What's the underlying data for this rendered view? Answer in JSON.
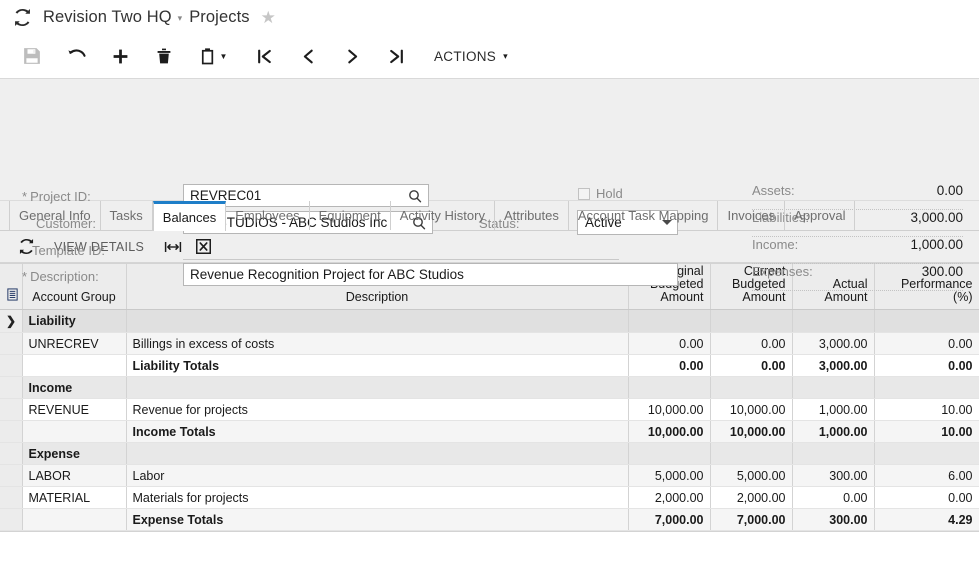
{
  "titlebar": {
    "refresh_icon": "refresh-icon",
    "company": "Revision Two HQ",
    "caret": "▾",
    "page": "Projects",
    "favorite_icon": "★"
  },
  "toolbar": {
    "buttons": [
      {
        "name": "save-button",
        "icon": "save-icon",
        "disabled": true
      },
      {
        "name": "undo-button",
        "icon": "undo-icon",
        "disabled": false
      },
      {
        "name": "add-button",
        "icon": "plus-icon",
        "disabled": false
      },
      {
        "name": "delete-button",
        "icon": "trash-icon",
        "disabled": false
      },
      {
        "name": "clipboard-button",
        "icon": "clipboard-icon",
        "disabled": false
      },
      {
        "name": "first-record-button",
        "icon": "first-icon",
        "disabled": false
      },
      {
        "name": "previous-record-button",
        "icon": "prev-icon",
        "disabled": false
      },
      {
        "name": "next-record-button",
        "icon": "next-icon",
        "disabled": false
      },
      {
        "name": "last-record-button",
        "icon": "last-icon",
        "disabled": false
      }
    ],
    "actions_label": "ACTIONS",
    "actions_caret": "▾"
  },
  "form": {
    "project_id": {
      "label": "Project ID:",
      "required": true,
      "value": "REVREC01",
      "placeholder": ""
    },
    "customer": {
      "label": "Customer:",
      "required": false,
      "value": "ABCSTUDIOS - ABC Studios Inc",
      "placeholder": ""
    },
    "template_id": {
      "label": "Template ID:",
      "required": false,
      "value": "",
      "placeholder": ""
    },
    "description": {
      "label": "Description:",
      "required": true,
      "value": "Revenue Recognition Project for ABC Studios",
      "placeholder": ""
    },
    "hold": {
      "label": "Hold",
      "checked": false
    },
    "status": {
      "label": "Status:",
      "value": "Active"
    },
    "summary": [
      {
        "label": "Assets:",
        "value": "0.00"
      },
      {
        "label": "Liabilities:",
        "value": "3,000.00"
      },
      {
        "label": "Income:",
        "value": "1,000.00"
      },
      {
        "label": "Expenses:",
        "value": "300.00"
      }
    ]
  },
  "tabs": [
    {
      "label": "General Info",
      "active": false
    },
    {
      "label": "Tasks",
      "active": false
    },
    {
      "label": "Balances",
      "active": true
    },
    {
      "label": "Employees",
      "active": false
    },
    {
      "label": "Equipment",
      "active": false
    },
    {
      "label": "Activity History",
      "active": false
    },
    {
      "label": "Attributes",
      "active": false
    },
    {
      "label": "Account Task Mapping",
      "active": false
    },
    {
      "label": "Invoices",
      "active": false
    },
    {
      "label": "Approval",
      "active": false
    }
  ],
  "gridbar": {
    "refresh_icon": "refresh-icon",
    "view_details_label": "VIEW DETAILS",
    "fit_columns_icon": "fit-width-icon",
    "export_excel_icon": "export-excel-icon"
  },
  "grid": {
    "columns": [
      {
        "key": "select",
        "label": "",
        "icon": "column-config-icon"
      },
      {
        "key": "account_group",
        "label": "Account Group"
      },
      {
        "key": "description",
        "label": "Description"
      },
      {
        "key": "original_budgeted_amount",
        "label": "Original Budgeted Amount"
      },
      {
        "key": "current_budgeted_amount",
        "label": "Current Budgeted Amount"
      },
      {
        "key": "actual_amount",
        "label": "Actual Amount"
      },
      {
        "key": "performance_pct",
        "label": "Performance (%)"
      }
    ],
    "rows": [
      {
        "kind": "group",
        "selected": true,
        "marker": "❯",
        "account_group": "Liability",
        "description": "",
        "original": "",
        "current": "",
        "actual": "",
        "performance": ""
      },
      {
        "kind": "data",
        "stripe": "alt",
        "marker": "",
        "account_group": "UNRECREV",
        "description": "Billings in excess of costs",
        "original": "0.00",
        "current": "0.00",
        "actual": "3,000.00",
        "performance": "0.00"
      },
      {
        "kind": "total",
        "stripe": "plain",
        "marker": "",
        "account_group": "",
        "description": "Liability Totals",
        "original": "0.00",
        "current": "0.00",
        "actual": "3,000.00",
        "performance": "0.00"
      },
      {
        "kind": "subgroup",
        "stripe": "alt",
        "marker": "",
        "account_group": "Income",
        "description": "",
        "original": "",
        "current": "",
        "actual": "",
        "performance": ""
      },
      {
        "kind": "data",
        "stripe": "plain",
        "marker": "",
        "account_group": "REVENUE",
        "description": "Revenue for projects",
        "original": "10,000.00",
        "current": "10,000.00",
        "actual": "1,000.00",
        "performance": "10.00"
      },
      {
        "kind": "total",
        "stripe": "alt",
        "marker": "",
        "account_group": "",
        "description": "Income Totals",
        "original": "10,000.00",
        "current": "10,000.00",
        "actual": "1,000.00",
        "performance": "10.00"
      },
      {
        "kind": "subgroup",
        "stripe": "plain",
        "marker": "",
        "account_group": "Expense",
        "description": "",
        "original": "",
        "current": "",
        "actual": "",
        "performance": ""
      },
      {
        "kind": "data",
        "stripe": "alt",
        "marker": "",
        "account_group": "LABOR",
        "description": "Labor",
        "original": "5,000.00",
        "current": "5,000.00",
        "actual": "300.00",
        "performance": "6.00"
      },
      {
        "kind": "data",
        "stripe": "plain",
        "marker": "",
        "account_group": "MATERIAL",
        "description": "Materials for projects",
        "original": "2,000.00",
        "current": "2,000.00",
        "actual": "0.00",
        "performance": "0.00"
      },
      {
        "kind": "total",
        "stripe": "alt",
        "marker": "",
        "account_group": "",
        "description": "Expense Totals",
        "original": "7,000.00",
        "current": "7,000.00",
        "actual": "300.00",
        "performance": "4.29"
      }
    ]
  },
  "colors": {
    "accent": "#1e7ec8",
    "panel": "#efefef",
    "grid_header": "#ececec",
    "group_row": "#e0e0e0"
  }
}
